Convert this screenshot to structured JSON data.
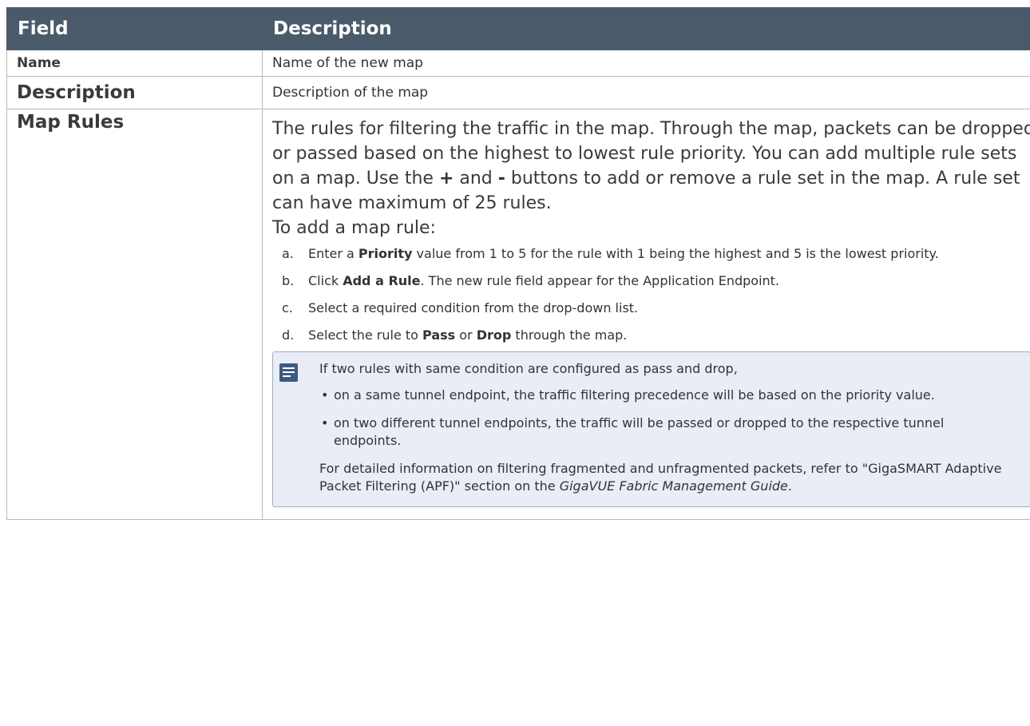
{
  "header": {
    "field": "Field",
    "description": "Description"
  },
  "rows": [
    {
      "field": "Name",
      "description": "Name of the new map"
    },
    {
      "field": "Description",
      "description": "Description of the map"
    }
  ],
  "map_rules": {
    "field": "Map Rules",
    "intro_1": "The rules for filtering the traffic in the map. Through the map, packets can be dropped or passed based on the highest to lowest rule priority. You can add multiple rule sets on a map. Use the ",
    "plus": "+",
    "and": " and ",
    "minus": "-",
    "intro_2": " buttons to add or remove a rule set in the map. A rule set can have maximum of 25 rules.",
    "intro_3": "To add a map rule:",
    "steps": {
      "a": {
        "letter": "a.",
        "pre": "Enter a ",
        "bold": "Priority",
        "post": " value from 1 to 5 for the rule with 1 being the highest and 5 is the lowest priority."
      },
      "b": {
        "letter": "b.",
        "pre": "Click ",
        "bold": "Add a Rule",
        "post": ". The new rule field appear for the Application Endpoint."
      },
      "c": {
        "letter": "c.",
        "text": "Select a required condition from the drop-down list."
      },
      "d": {
        "letter": "d.",
        "pre": "Select the rule to ",
        "bold1": "Pass",
        "mid": " or ",
        "bold2": "Drop",
        "post": " through the map."
      }
    },
    "note": {
      "icon": "note-icon",
      "lead": "If two rules with same condition are configured as pass and drop,",
      "bullets": [
        "on a same tunnel endpoint, the traffic filtering precedence will be based on the priority value.",
        "on two different tunnel endpoints, the traffic will be passed or dropped to the respective tunnel endpoints."
      ],
      "tail_pre": "For detailed information on filtering fragmented and unfragmented packets, refer to  \"GigaSMART Adaptive Packet Filtering (APF)\" section on the ",
      "tail_em": "GigaVUE Fabric Management Guide",
      "tail_post": "."
    }
  }
}
